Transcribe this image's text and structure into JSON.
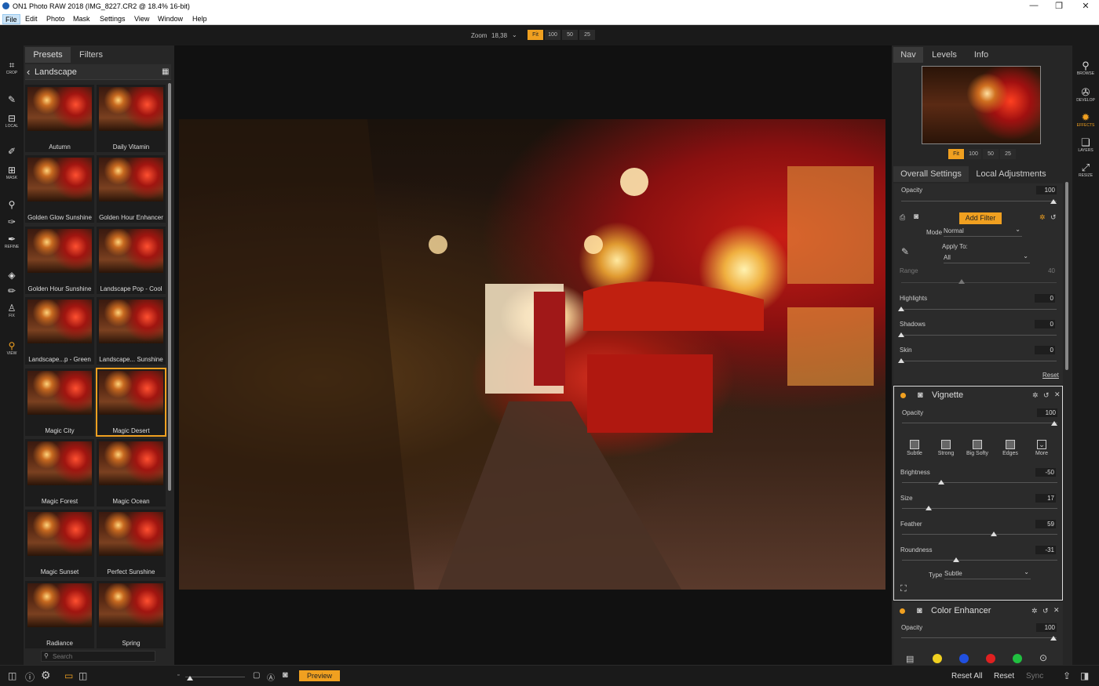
{
  "window": {
    "title": "ON1 Photo RAW 2018 (IMG_8227.CR2 @ 18.4% 16-bit)"
  },
  "menu": [
    "File",
    "Edit",
    "Photo",
    "Mask",
    "Settings",
    "View",
    "Window",
    "Help"
  ],
  "topbar": {
    "zoom_label": "Zoom",
    "zoom_value": "18,38",
    "zoom_buttons": [
      "Fit",
      "100",
      "50",
      "25"
    ]
  },
  "left_tools": {
    "crop": "CROP",
    "local": "LOCAL",
    "mask": "MASK",
    "refine": "REFINE",
    "fix": "FIX",
    "view": "VIEW"
  },
  "presets": {
    "tabs": [
      "Presets",
      "Filters"
    ],
    "category": "Landscape",
    "items": [
      "Autumn",
      "Daily Vitamin",
      "Golden Glow Sunshine",
      "Golden Hour Enhancer",
      "Golden Hour Sunshine",
      "Landscape Pop - Cool",
      "Landscape...p - Green",
      "Landscape... Sunshine",
      "Magic City",
      "Magic Desert",
      "Magic Forest",
      "Magic Ocean",
      "Magic Sunset",
      "Perfect Sunshine",
      "Radiance",
      "Spring"
    ],
    "selected": "Magic Desert",
    "search_placeholder": "Search"
  },
  "nav": {
    "tabs": [
      "Nav",
      "Levels",
      "Info"
    ],
    "zoom_buttons": [
      "Fit",
      "100",
      "50",
      "25"
    ]
  },
  "settings_tabs": [
    "Overall Settings",
    "Local Adjustments"
  ],
  "overall": {
    "opacity_label": "Opacity",
    "opacity_value": "100",
    "add_filter": "Add Filter",
    "mode_label": "Mode",
    "mode_value": "Normal",
    "apply_to_label": "Apply To:",
    "apply_to_value": "All",
    "range_label": "Range",
    "range_value": "40",
    "highlights_label": "Highlights",
    "highlights_value": "0",
    "shadows_label": "Shadows",
    "shadows_value": "0",
    "skin_label": "Skin",
    "skin_value": "0",
    "reset": "Reset"
  },
  "vignette": {
    "title": "Vignette",
    "opacity_label": "Opacity",
    "opacity_value": "100",
    "presets": [
      "Subtle",
      "Strong",
      "Big Softy",
      "Edges",
      "More"
    ],
    "brightness_label": "Brightness",
    "brightness_value": "-50",
    "brightness_level": 0.25,
    "size_label": "Size",
    "size_value": "17",
    "size_level": 0.17,
    "feather_label": "Feather",
    "feather_value": "59",
    "feather_level": 0.59,
    "roundness_label": "Roundness",
    "roundness_value": "-31",
    "roundness_level": 0.35,
    "type_label": "Type",
    "type_value": "Subtle"
  },
  "color_enhancer": {
    "title": "Color Enhancer",
    "opacity_label": "Opacity",
    "opacity_value": "100",
    "colors": [
      "#f0d020",
      "#2050e0",
      "#e02020",
      "#20c040"
    ]
  },
  "right_tools": {
    "browse": "BROWSE",
    "develop": "DEVELOP",
    "effects": "EFFECTS",
    "layers": "LAYERS",
    "resize": "RESIZE"
  },
  "bottombar": {
    "preview": "Preview",
    "reset_all": "Reset All",
    "reset": "Reset",
    "sync": "Sync"
  },
  "colors": {
    "accent": "#f0a020"
  }
}
